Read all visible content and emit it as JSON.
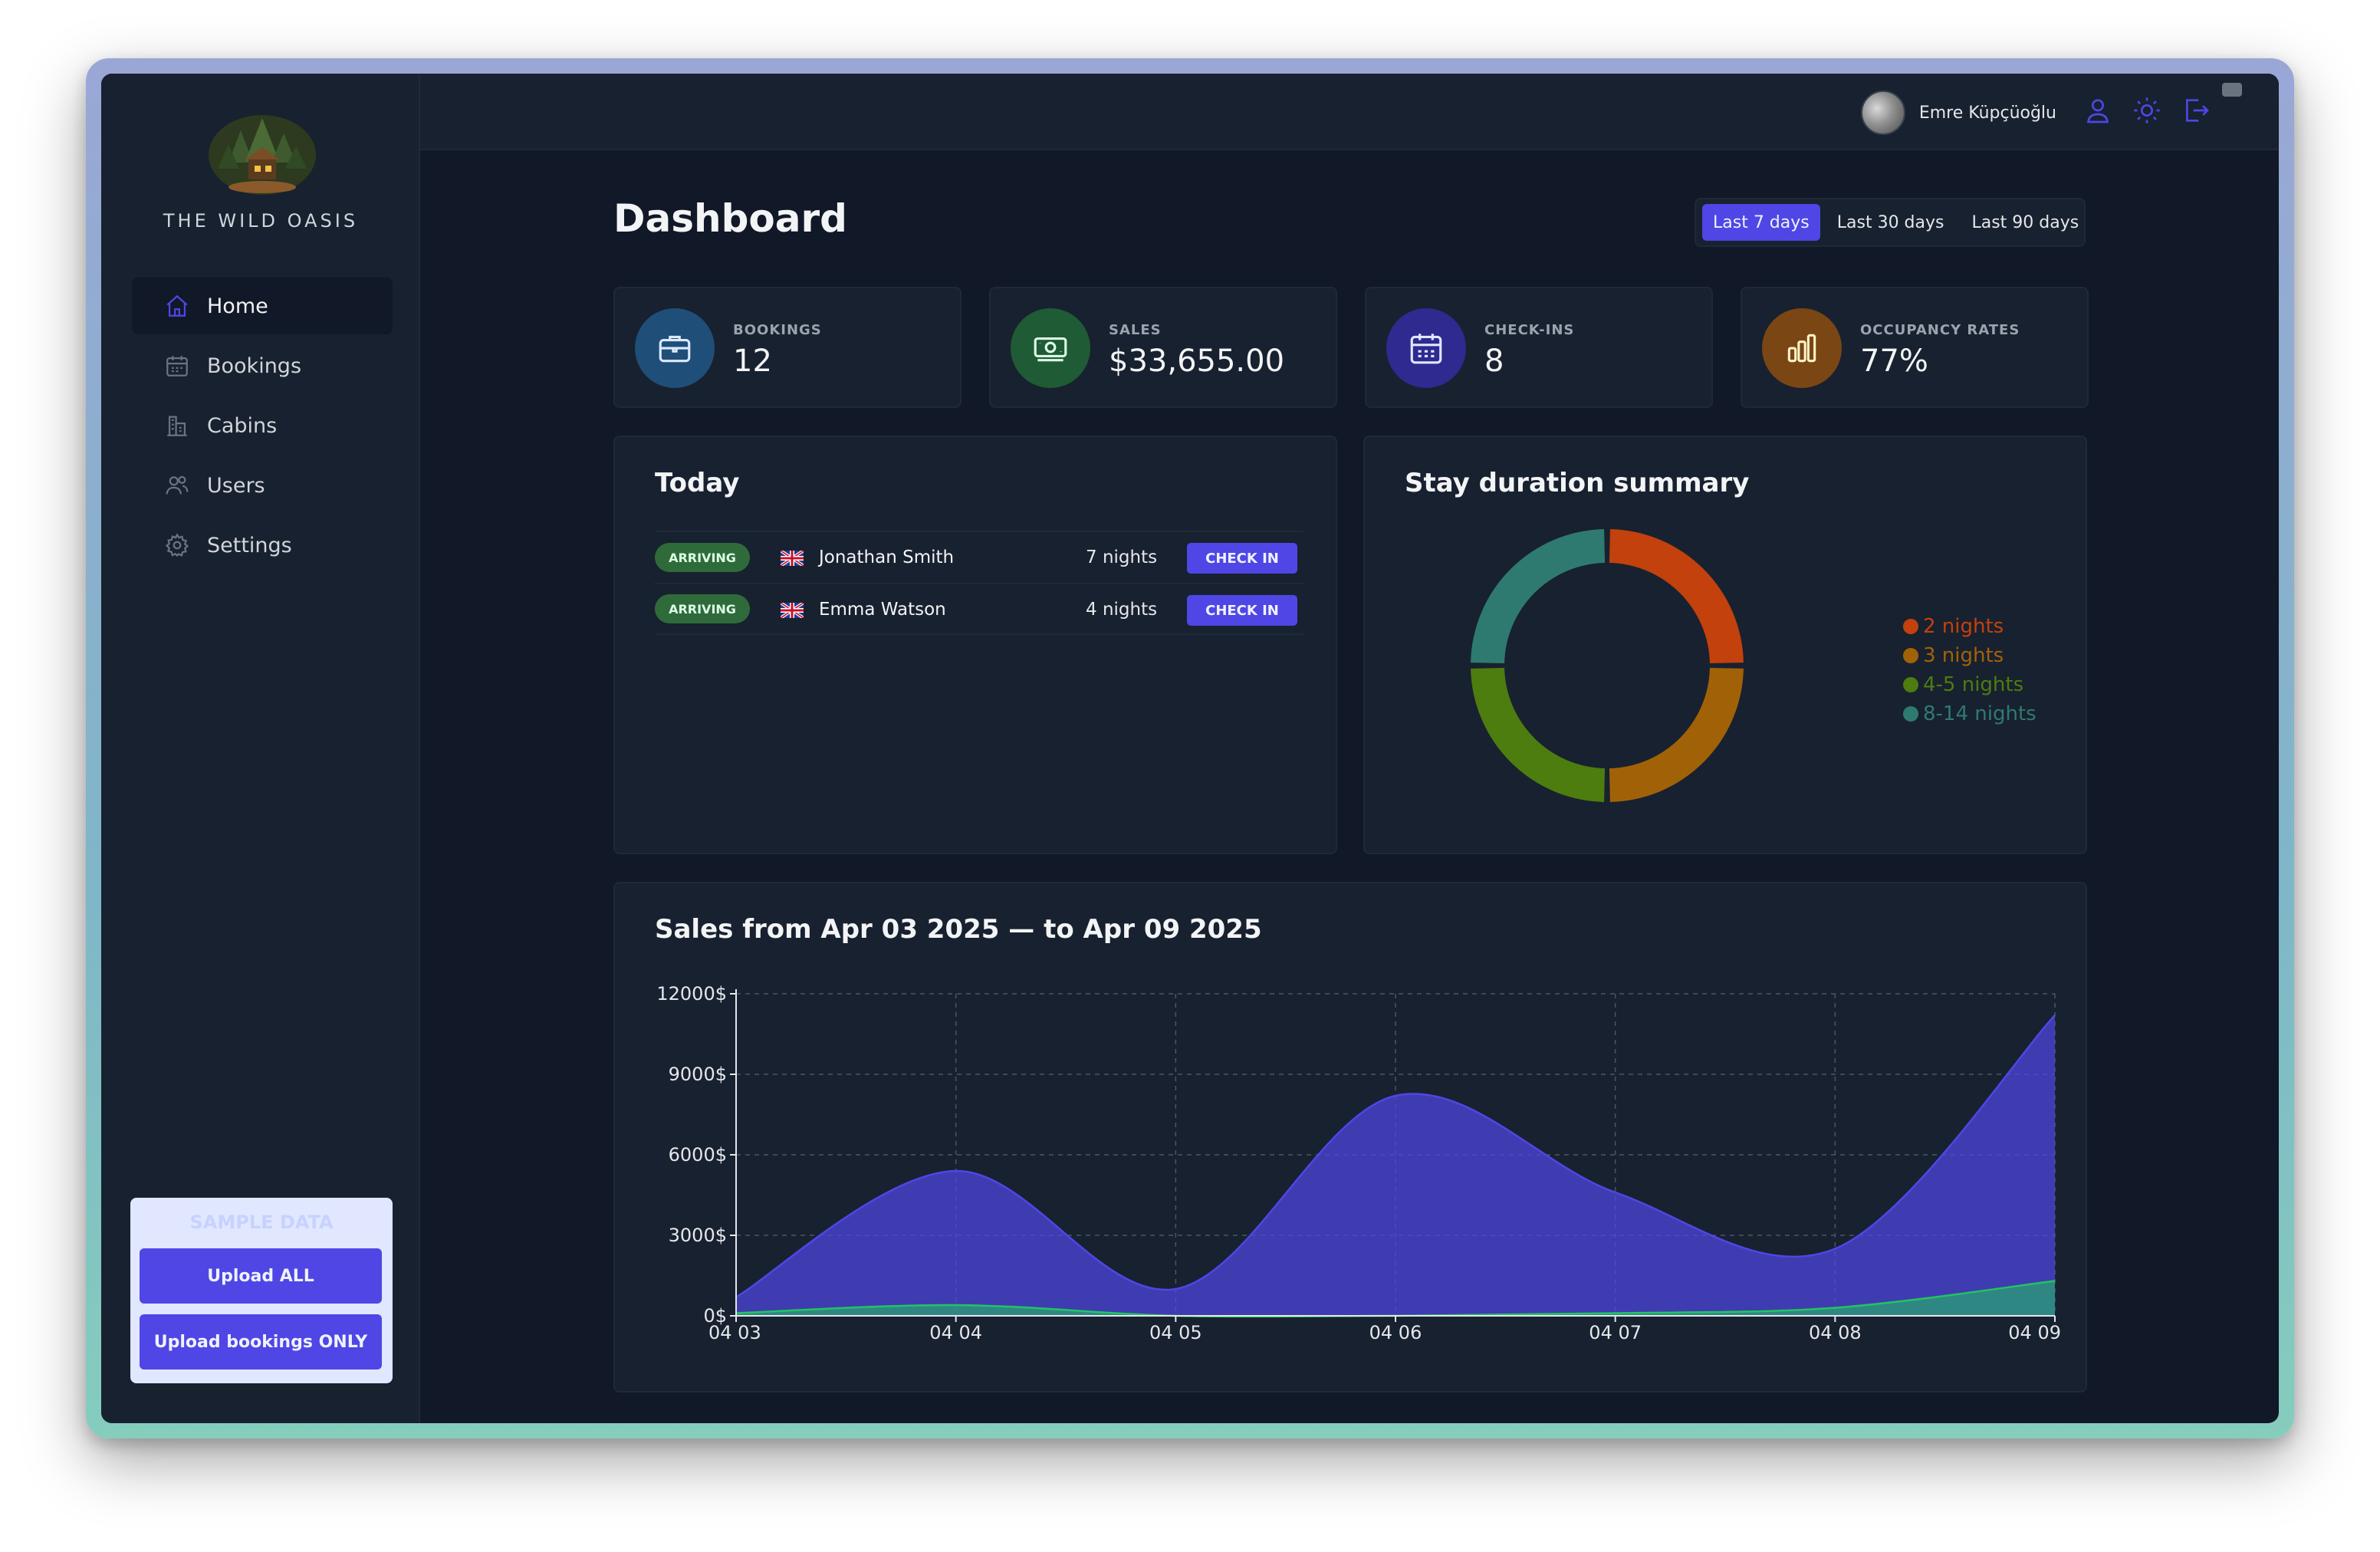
{
  "app": {
    "brand": "THE WILD OASIS",
    "user_name": "Emre Küpçüoğlu"
  },
  "sidebar": {
    "items": [
      {
        "label": "Home",
        "icon": "home-icon",
        "active": true
      },
      {
        "label": "Bookings",
        "icon": "calendar-icon"
      },
      {
        "label": "Cabins",
        "icon": "cabin-icon"
      },
      {
        "label": "Users",
        "icon": "users-icon"
      },
      {
        "label": "Settings",
        "icon": "gear-icon"
      }
    ],
    "uploader": {
      "title": "SAMPLE DATA",
      "upload_all": "Upload ALL",
      "upload_bookings": "Upload bookings ONLY"
    }
  },
  "header": {
    "icons": [
      "user-icon",
      "sun-icon",
      "logout-icon"
    ]
  },
  "main": {
    "title": "Dashboard",
    "filters": [
      "Last 7 days",
      "Last 30 days",
      "Last 90 days"
    ],
    "active_filter": "Last 7 days",
    "stats": [
      {
        "label": "BOOKINGS",
        "value": "12",
        "icon": "briefcase-icon",
        "color": "#1f4e79"
      },
      {
        "label": "SALES",
        "value": "$33,655.00",
        "icon": "banknote-icon",
        "color": "#1f5b35"
      },
      {
        "label": "CHECK-INS",
        "value": "8",
        "icon": "calendar-icon",
        "color": "#2e2a8f"
      },
      {
        "label": "OCCUPANCY RATES",
        "value": "77%",
        "icon": "bar-chart-icon",
        "color": "#7a4614"
      }
    ],
    "today": {
      "title": "Today",
      "rows": [
        {
          "status": "ARRIVING",
          "guest": "Jonathan Smith",
          "nights": "7 nights",
          "action": "CHECK IN"
        },
        {
          "status": "ARRIVING",
          "guest": "Emma Watson",
          "nights": "4 nights",
          "action": "CHECK IN"
        }
      ]
    },
    "duration": {
      "title": "Stay duration summary",
      "legend": [
        {
          "label": "2 nights",
          "color": "#c2410c"
        },
        {
          "label": "3 nights",
          "color": "#a16207"
        },
        {
          "label": "4-5 nights",
          "color": "#4d7c0f"
        },
        {
          "label": "8-14 nights",
          "color": "#2f7a70"
        }
      ]
    },
    "sales": {
      "title": "Sales from Apr 03 2025 — to Apr 09 2025"
    }
  },
  "chart_data": [
    {
      "type": "pie",
      "title": "Stay duration summary",
      "categories": [
        "2 nights",
        "3 nights",
        "4-5 nights",
        "8-14 nights"
      ],
      "values": [
        1,
        1,
        1,
        1
      ],
      "colors": [
        "#c2410c",
        "#a16207",
        "#4d7c0f",
        "#2f7a70"
      ],
      "legend": "right"
    },
    {
      "type": "area",
      "title": "Sales from Apr 03 2025 — to Apr 09 2025",
      "categories": [
        "04 03",
        "04 04",
        "04 05",
        "04 06",
        "04 07",
        "04 08",
        "04 09"
      ],
      "series": [
        {
          "values": [
            700,
            5400,
            1000,
            8200,
            4600,
            2500,
            11200
          ],
          "color": "#4f46e5"
        },
        {
          "values": [
            100,
            400,
            0,
            0,
            100,
            300,
            1300
          ],
          "color": "#22c55e"
        }
      ],
      "ylim": [
        0,
        12000
      ],
      "yticks": [
        "0$",
        "3000$",
        "6000$",
        "9000$",
        "12000$"
      ],
      "grid": true
    }
  ]
}
